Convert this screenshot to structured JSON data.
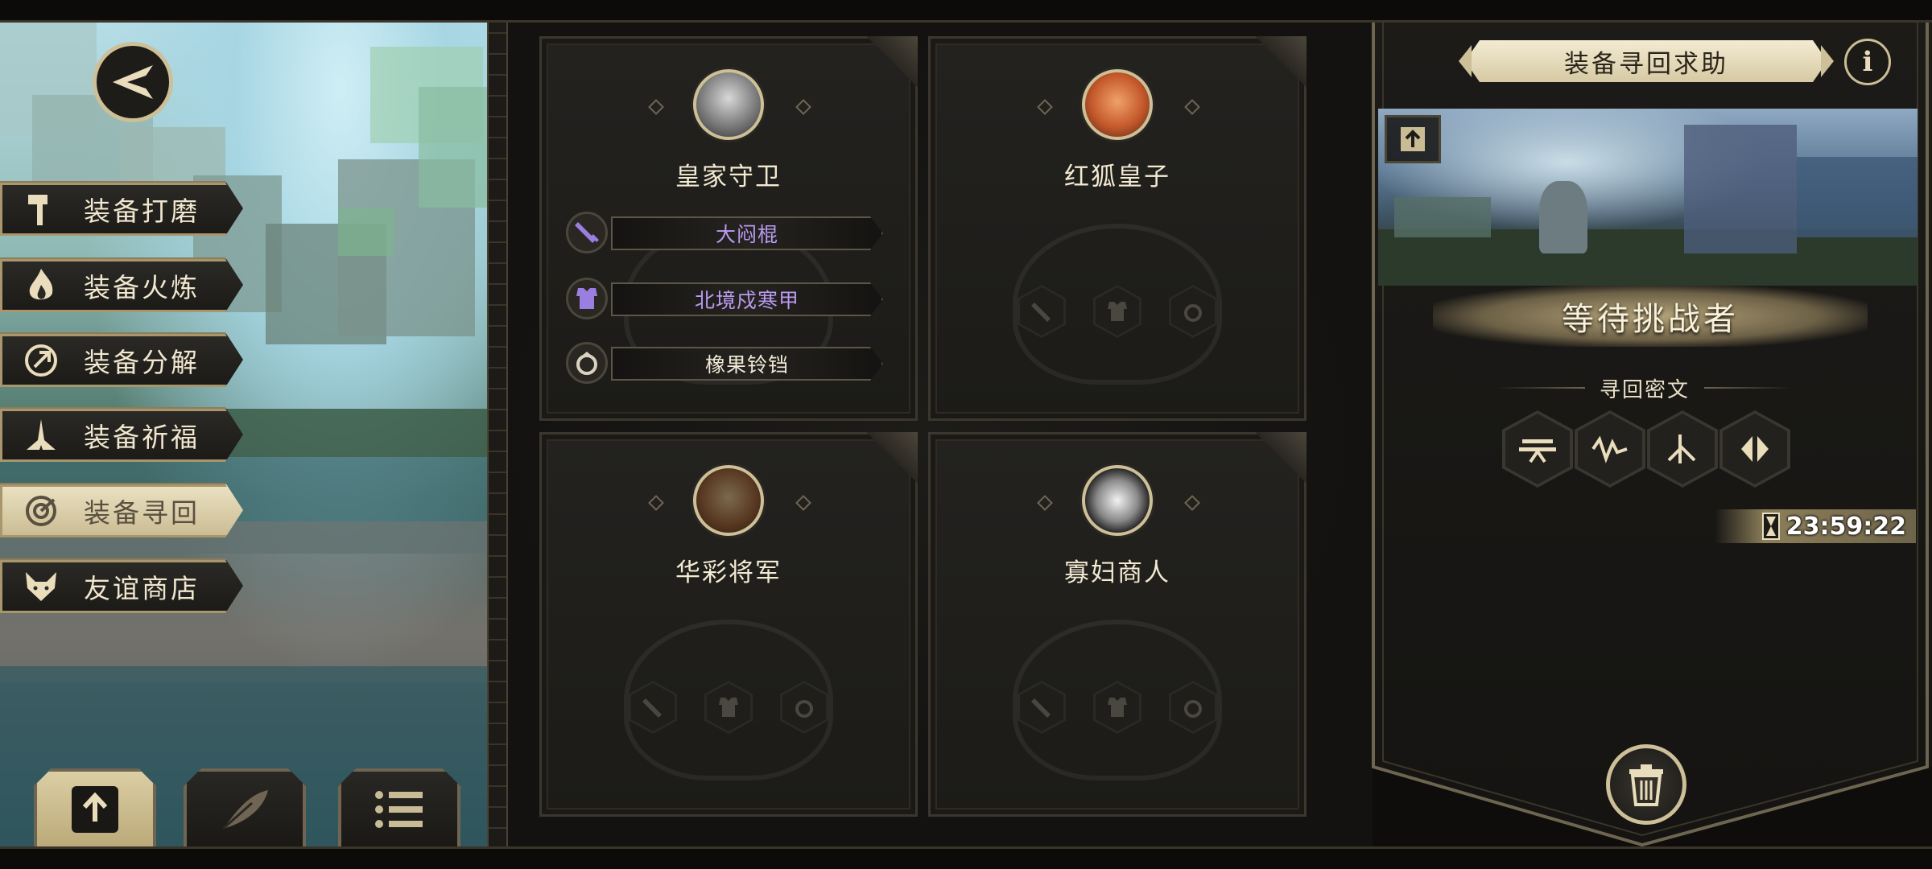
{
  "left_menu": {
    "items": [
      {
        "label": "装备打磨",
        "icon": "hammer-icon",
        "active": false
      },
      {
        "label": "装备火炼",
        "icon": "flame-icon",
        "active": false
      },
      {
        "label": "装备分解",
        "icon": "disassemble-icon",
        "active": false
      },
      {
        "label": "装备祈福",
        "icon": "pray-hands-icon",
        "active": false
      },
      {
        "label": "装备寻回",
        "icon": "target-icon",
        "active": true
      },
      {
        "label": "友谊商店",
        "icon": "fox-icon",
        "active": false
      }
    ],
    "bottom_buttons": [
      {
        "icon": "upload-icon",
        "active": true
      },
      {
        "icon": "feather-icon",
        "active": false
      },
      {
        "icon": "list-icon",
        "active": false
      }
    ]
  },
  "characters": [
    {
      "name": "皇家守卫",
      "avatar": "royal-guard-avatar",
      "equipment": [
        {
          "slot": "weapon",
          "icon": "sword-icon",
          "name": "大闷棍",
          "color": "#b99af0"
        },
        {
          "slot": "armor",
          "icon": "armor-icon",
          "name": "北境戍寒甲",
          "color": "#b99af0"
        },
        {
          "slot": "ring",
          "icon": "ring-icon",
          "name": "橡果铃铛",
          "color": "#f2ead6"
        }
      ]
    },
    {
      "name": "红狐皇子",
      "avatar": "red-fox-prince-avatar",
      "equipment": []
    },
    {
      "name": "华彩将军",
      "avatar": "colorful-general-avatar",
      "equipment": []
    },
    {
      "name": "寡妇商人",
      "avatar": "widow-merchant-avatar",
      "equipment": []
    }
  ],
  "right_panel": {
    "title": "装备寻回求助",
    "info_icon": "i",
    "status": "等待挑战者",
    "cipher_label": "寻回密文",
    "runes": [
      "rune-1-icon",
      "rune-2-icon",
      "rune-3-icon",
      "rune-4-icon"
    ],
    "timer": "23:59:22"
  },
  "colors": {
    "gold": "#cdbf97",
    "rare_purple": "#b99af0",
    "panel_dark": "#1c1b18"
  }
}
